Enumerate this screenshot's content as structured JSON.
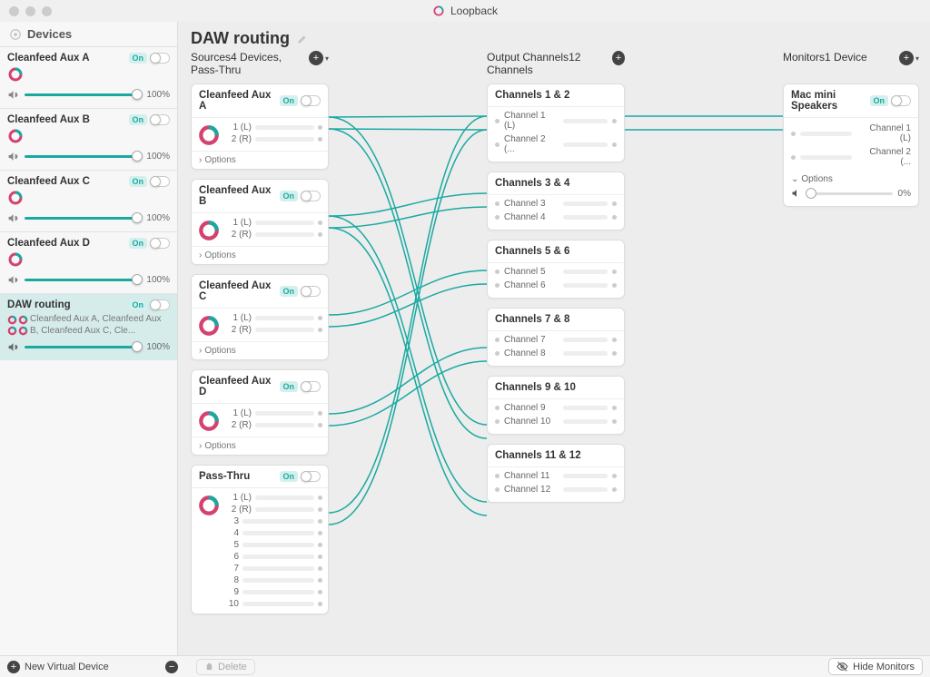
{
  "app": {
    "title": "Loopback"
  },
  "sidebar": {
    "header": "Devices",
    "devices": [
      {
        "name": "Cleanfeed Aux A",
        "state": "On",
        "volume": "100%"
      },
      {
        "name": "Cleanfeed Aux B",
        "state": "On",
        "volume": "100%"
      },
      {
        "name": "Cleanfeed Aux C",
        "state": "On",
        "volume": "100%"
      },
      {
        "name": "Cleanfeed Aux D",
        "state": "On",
        "volume": "100%"
      },
      {
        "name": "DAW routing",
        "state": "On",
        "volume": "100%",
        "sub": "Cleanfeed Aux A, Cleanfeed Aux B, Cleanfeed Aux C, Cle..."
      }
    ]
  },
  "page": {
    "title": "DAW routing"
  },
  "columns": {
    "sources": {
      "title": "Sources",
      "sub": "4 Devices, Pass-Thru"
    },
    "outputs": {
      "title": "Output Channels",
      "sub": "12 Channels"
    },
    "monitors": {
      "title": "Monitors",
      "sub": "1 Device"
    }
  },
  "sources": [
    {
      "title": "Cleanfeed Aux A",
      "state": "On",
      "ch1": "1 (L)",
      "ch2": "2 (R)",
      "options": "Options"
    },
    {
      "title": "Cleanfeed Aux B",
      "state": "On",
      "ch1": "1 (L)",
      "ch2": "2 (R)",
      "options": "Options"
    },
    {
      "title": "Cleanfeed Aux C",
      "state": "On",
      "ch1": "1 (L)",
      "ch2": "2 (R)",
      "options": "Options"
    },
    {
      "title": "Cleanfeed Aux D",
      "state": "On",
      "ch1": "1 (L)",
      "ch2": "2 (R)",
      "options": "Options"
    }
  ],
  "passthru": {
    "title": "Pass-Thru",
    "state": "On",
    "ch1": "1 (L)",
    "ch2": "2 (R)",
    "c3": "3",
    "c4": "4",
    "c5": "5",
    "c6": "6",
    "c7": "7",
    "c8": "8",
    "c9": "9",
    "c10": "10"
  },
  "outputs": [
    {
      "title": "Channels 1 & 2",
      "a": "Channel 1 (L)",
      "b": "Channel 2 (..."
    },
    {
      "title": "Channels 3 & 4",
      "a": "Channel 3",
      "b": "Channel 4"
    },
    {
      "title": "Channels 5 & 6",
      "a": "Channel 5",
      "b": "Channel 6"
    },
    {
      "title": "Channels 7 & 8",
      "a": "Channel 7",
      "b": "Channel 8"
    },
    {
      "title": "Channels 9 & 10",
      "a": "Channel 9",
      "b": "Channel 10"
    },
    {
      "title": "Channels 11 & 12",
      "a": "Channel 11",
      "b": "Channel 12"
    }
  ],
  "monitor": {
    "title": "Mac mini Speakers",
    "state": "On",
    "a": "Channel 1 (L)",
    "b": "Channel 2 (...",
    "options": "Options",
    "vol": "0%"
  },
  "footer": {
    "newDevice": "New Virtual Device",
    "delete": "Delete",
    "hideMonitors": "Hide Monitors"
  }
}
